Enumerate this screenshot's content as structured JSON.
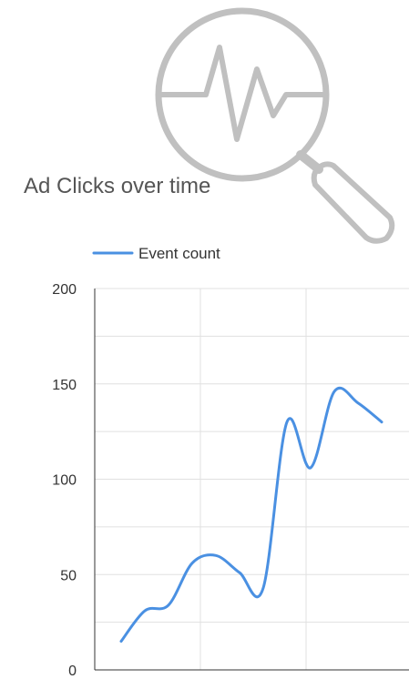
{
  "chart_data": {
    "type": "line",
    "title": "Ad Clicks over time",
    "xlabel": "",
    "ylabel": "",
    "ylim": [
      0,
      200
    ],
    "yticks": [
      "0",
      "50",
      "100",
      "150",
      "200"
    ],
    "grid": true,
    "legend_position": "top-left",
    "series": [
      {
        "name": "Event count",
        "color": "#4a90e2",
        "x": [
          0,
          1,
          2,
          3,
          4,
          5,
          6,
          7,
          8,
          9,
          10,
          11
        ],
        "values": [
          15,
          31,
          34,
          56,
          60,
          51,
          43,
          130,
          106,
          146,
          140,
          130
        ]
      }
    ]
  },
  "decoration": {
    "icon": "magnifier-heartbeat-icon",
    "icon_color": "#c0c0c0"
  }
}
